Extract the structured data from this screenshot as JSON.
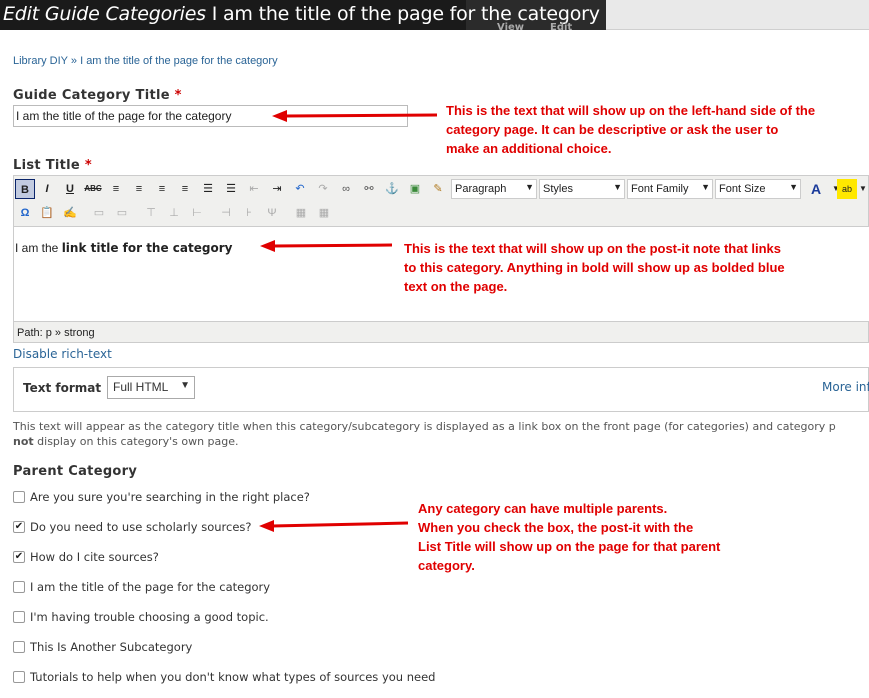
{
  "header": {
    "title_italic": "Edit Guide Categories",
    "title_rest": "I am the title of the page for the category",
    "tab_view": "View",
    "tab_edit": "Edit"
  },
  "breadcrumb": {
    "home": "Library DIY",
    "separator": "»",
    "current": "I am the title of the page for the category"
  },
  "guide_title": {
    "label": "Guide Category Title",
    "required": "*",
    "value": "I am the title of the page for the category"
  },
  "list_title": {
    "label": "List Title",
    "required": "*"
  },
  "editor": {
    "toolbar": {
      "bold": "B",
      "italic": "I",
      "underline": "U",
      "strike": "ABC",
      "paragraph": "Paragraph",
      "styles": "Styles",
      "font_family": "Font Family",
      "font_size": "Font Size"
    },
    "content_plain": "I am the ",
    "content_bold": "link title for the category",
    "path": "Path: p » strong"
  },
  "disable_rich_text": "Disable rich-text",
  "text_format": {
    "label": "Text format",
    "selected": "Full HTML",
    "more_info": "More inf"
  },
  "description": {
    "line1": "This text will appear as the category title when this category/subcategory is displayed as a link box on the front page (for categories) and category p",
    "line2_bold": "not",
    "line2_rest": " display on this category's own page."
  },
  "parent_category": {
    "label": "Parent Category",
    "options": [
      {
        "label": "Are you sure you're searching in the right place?",
        "checked": false
      },
      {
        "label": "Do you need to use scholarly sources?",
        "checked": true
      },
      {
        "label": "How do I cite sources?",
        "checked": true
      },
      {
        "label": "I am the title of the page for the category",
        "checked": false
      },
      {
        "label": "I'm having trouble choosing a good topic.",
        "checked": false
      },
      {
        "label": "This Is Another Subcategory",
        "checked": false
      },
      {
        "label": "Tutorials to help when you don't know what types of sources you need",
        "checked": false
      }
    ]
  },
  "annotations": {
    "title_note": [
      "This is the text that will show up on the left-hand side of the",
      "category page. It can be descriptive or ask the user to",
      "make an additional  choice."
    ],
    "list_note": [
      "This is the text that will show up on the post-it note that links",
      "to this category. Anything in bold will show up as bolded blue",
      "text on the page."
    ],
    "parent_note": [
      "Any category can have multiple parents.",
      "When you check the box, the post-it with the",
      "List Title will show up on the page for that parent",
      "category."
    ]
  },
  "colors": {
    "annotation": "#e00000",
    "link": "#2a6496",
    "header_bg": "#1a1a1a"
  }
}
